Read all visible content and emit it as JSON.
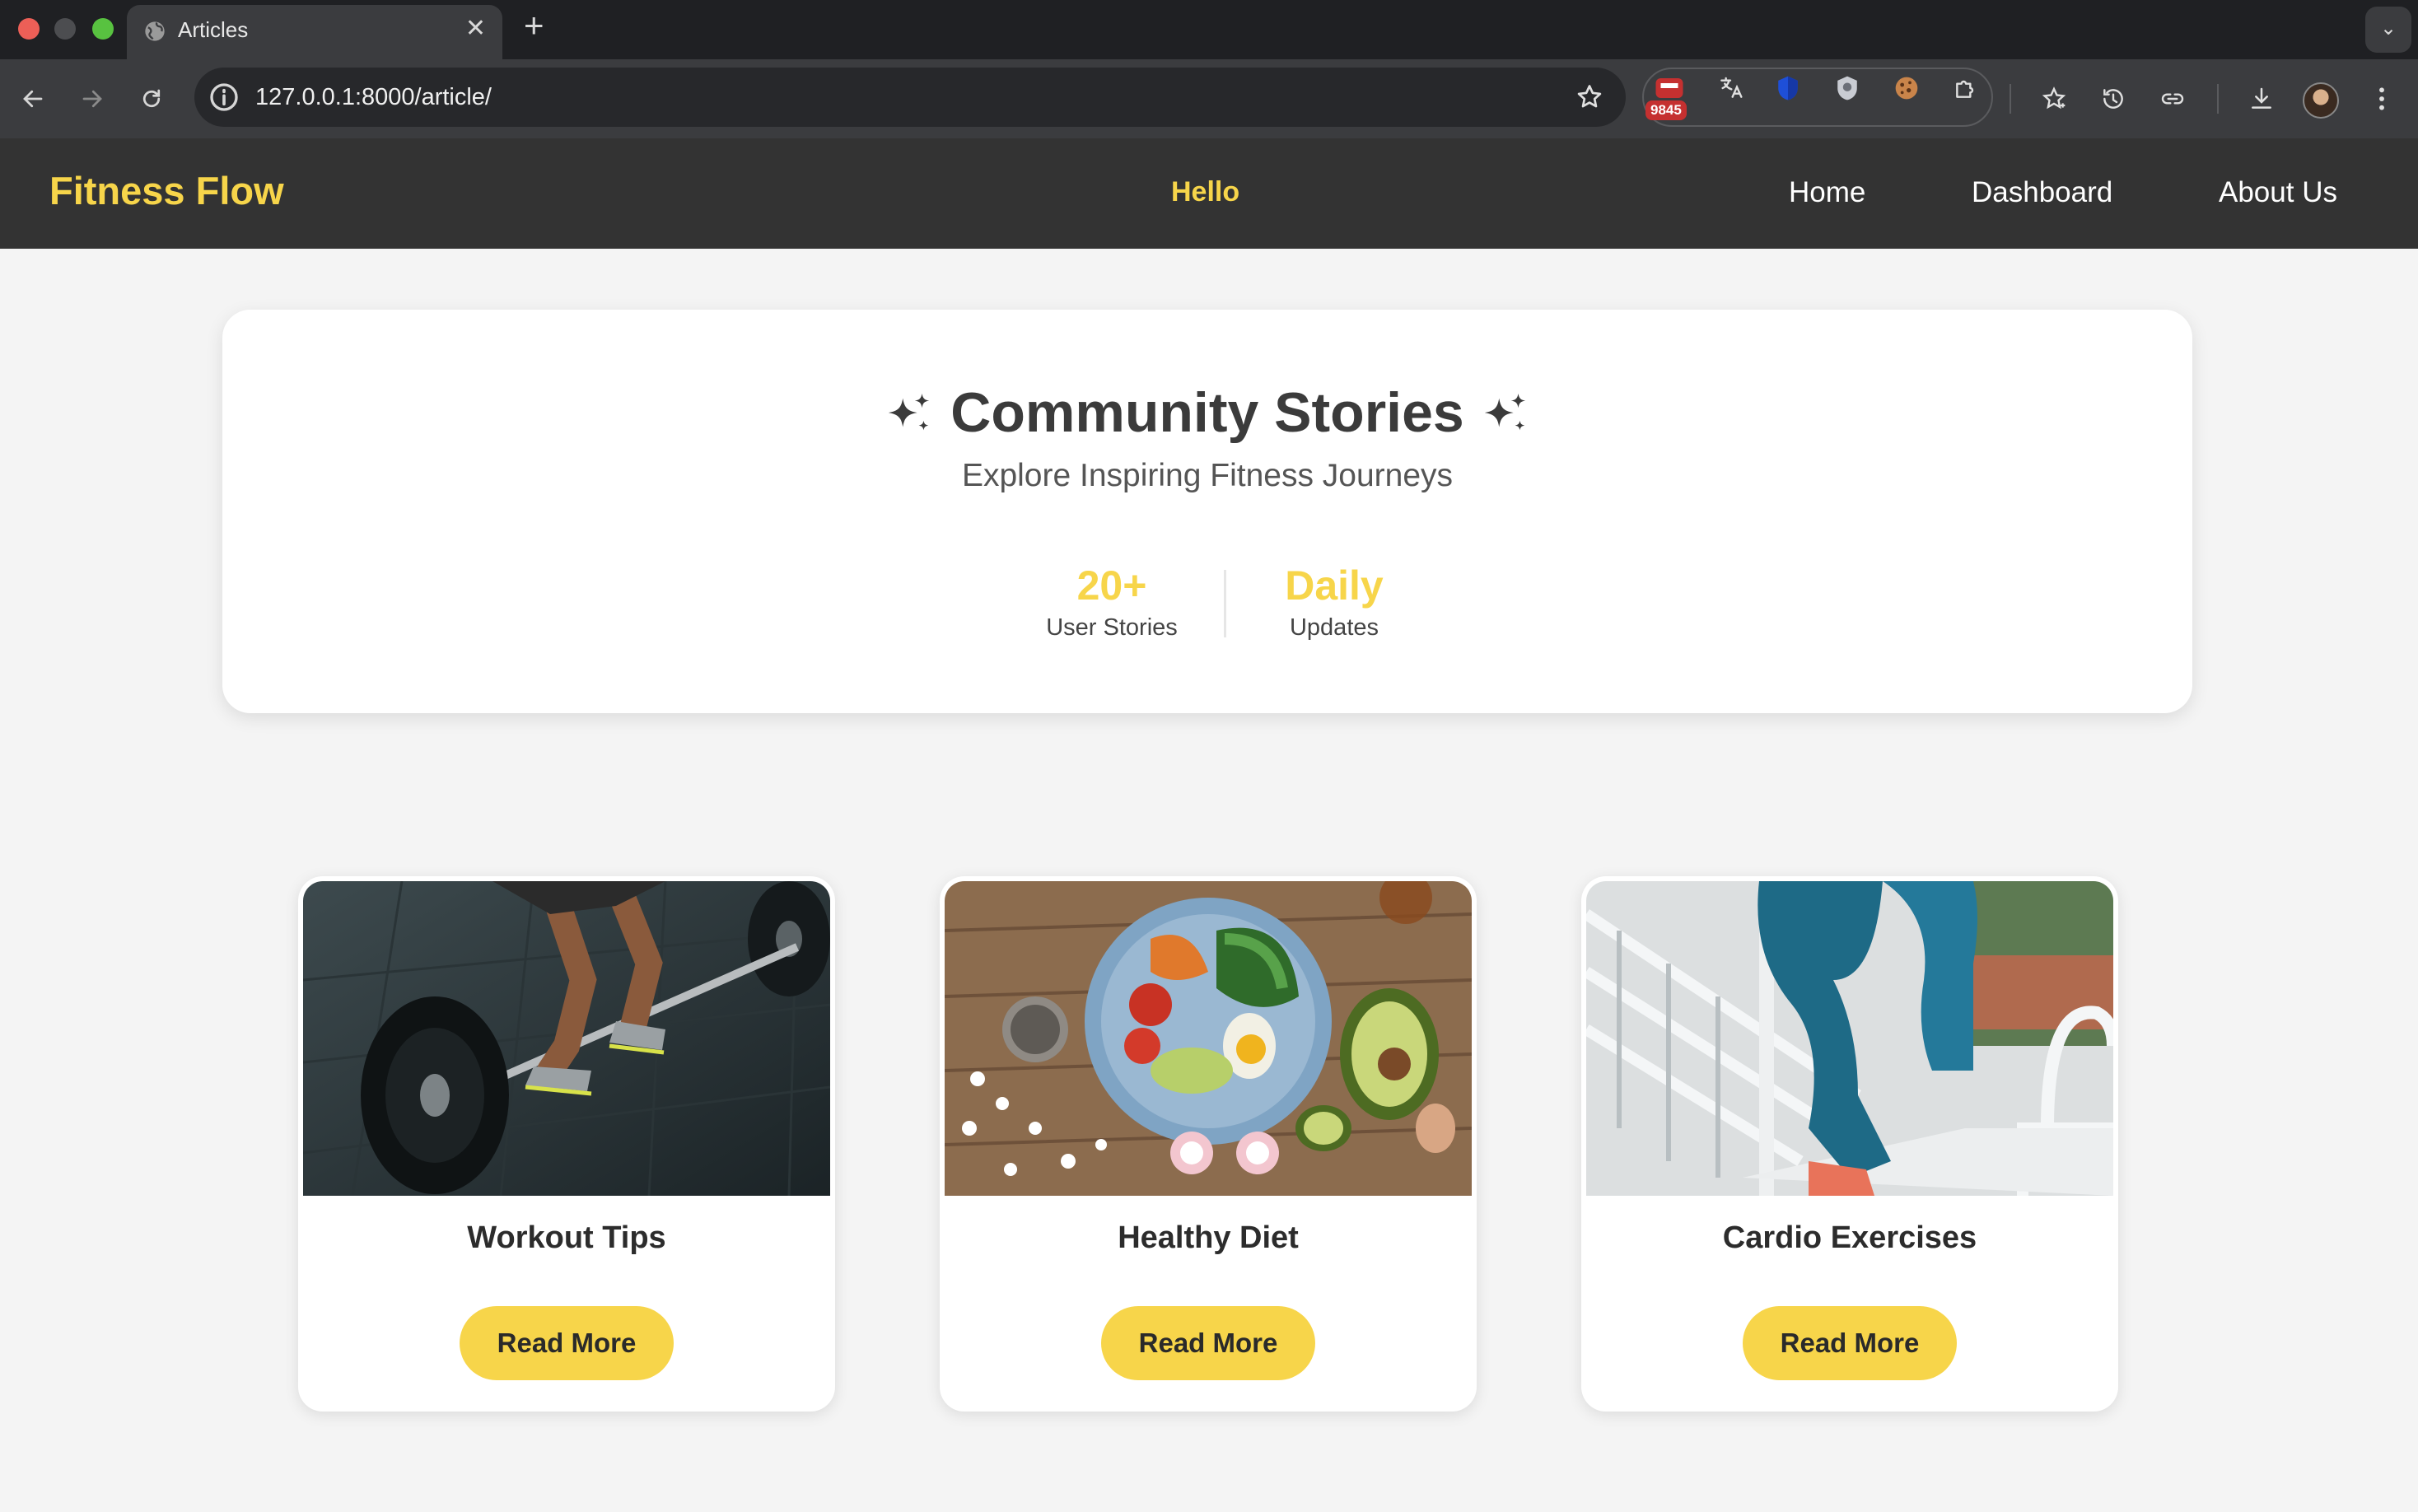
{
  "browser": {
    "tab_title": "Articles",
    "url": "127.0.0.1:8000/article/",
    "extension_badge": "9845"
  },
  "site": {
    "brand": "Fitness Flow",
    "greeting": "Hello",
    "nav": [
      "Home",
      "Dashboard",
      "About Us"
    ]
  },
  "hero": {
    "title": "Community Stories",
    "subtitle": "Explore Inspiring Fitness Journeys",
    "stats": [
      {
        "value": "20+",
        "label": "User Stories"
      },
      {
        "value": "Daily",
        "label": "Updates"
      }
    ]
  },
  "articles": [
    {
      "title": "Workout Tips",
      "button": "Read More"
    },
    {
      "title": "Healthy Diet",
      "button": "Read More"
    },
    {
      "title": "Cardio Exercises",
      "button": "Read More"
    }
  ],
  "colors": {
    "accent": "#f7d54a",
    "nav_bg": "#333333",
    "page_bg": "#f4f4f4"
  }
}
